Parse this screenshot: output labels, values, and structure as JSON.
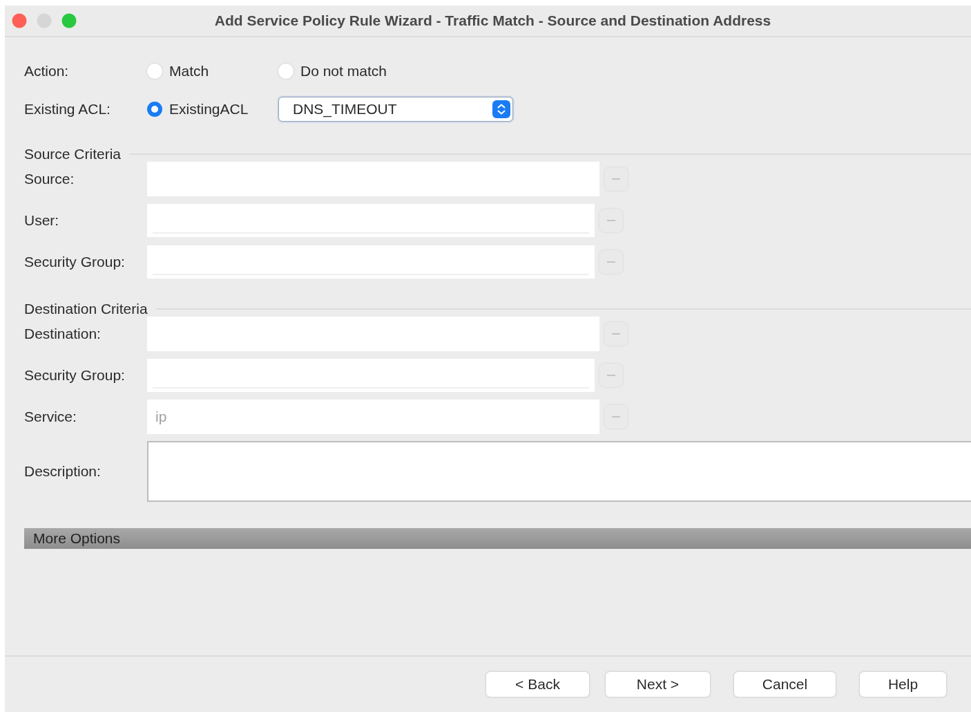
{
  "window": {
    "title": "Add Service Policy Rule Wizard - Traffic Match - Source and Destination Address"
  },
  "action": {
    "label": "Action:",
    "options": [
      {
        "label": "Match",
        "selected": false
      },
      {
        "label": "Do not match",
        "selected": false
      }
    ]
  },
  "existing_acl": {
    "label": "Existing ACL:",
    "option": {
      "label": "ExistingACL",
      "selected": true
    },
    "value": "DNS_TIMEOUT"
  },
  "sections": [
    {
      "title": "Source Criteria",
      "fields": [
        {
          "label": "Source:",
          "kind": "plain"
        },
        {
          "label": "User:",
          "kind": "inset"
        },
        {
          "label": "Security Group:",
          "kind": "inset"
        }
      ]
    },
    {
      "title": "Destination Criteria",
      "fields": [
        {
          "label": "Destination:",
          "kind": "plain"
        },
        {
          "label": "Security Group:",
          "kind": "inset"
        },
        {
          "label": "Service:",
          "kind": "plain",
          "value": "ip"
        }
      ]
    }
  ],
  "description": {
    "label": "Description:"
  },
  "more_options": {
    "label": "More Options"
  },
  "buttons": [
    "< Back",
    "Next >",
    "Cancel",
    "Help"
  ]
}
